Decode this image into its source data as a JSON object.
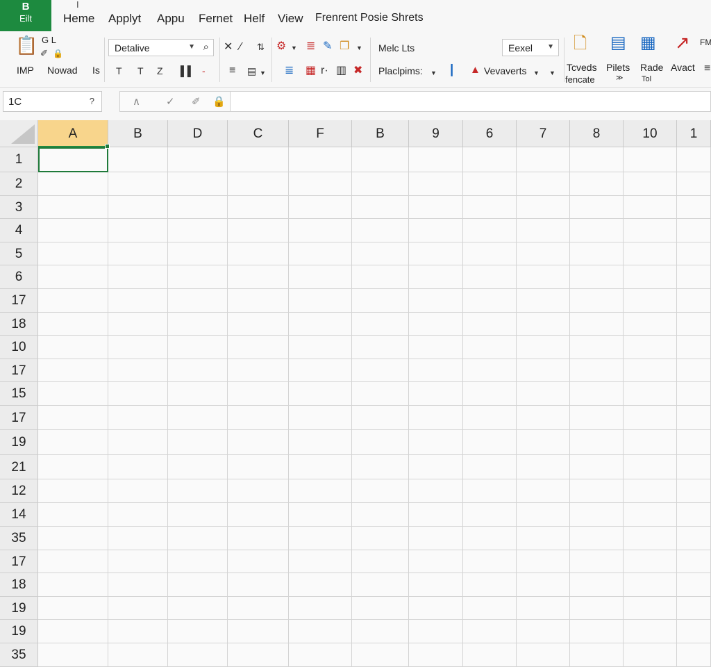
{
  "app": {
    "file_tab_line1": "B",
    "file_tab_line2": "Eilt",
    "accent_color": "#1d8a3f",
    "cursor_glyph": "I"
  },
  "menu": [
    {
      "label": "Heme"
    },
    {
      "label": "Applyt"
    },
    {
      "label": "Appu"
    },
    {
      "label": "Fernet"
    },
    {
      "label": "Helf"
    },
    {
      "label": "View"
    },
    {
      "label": "Frenrent Posie Shrets"
    }
  ],
  "ribbon": {
    "paste_label": "IMP",
    "nowad_label": "Nowad",
    "is_label": "Is",
    "gl_label": "G L",
    "font_box": "Detalive",
    "melk_label": "Melc Lts",
    "plac_label": "Placlpims:",
    "vevaverts_label": "Vevaverts",
    "format_box": "Eexel",
    "tcveds_label": "Tcveds",
    "fencate_label": "fencate",
    "pilets_label": "Pilets",
    "pilets_sub": "≫",
    "rade_label": "Rade",
    "rade_sub": "Tol",
    "avact_label": "Avact",
    "fm_label": "FM"
  },
  "icons": {
    "paste": "clipboard-icon",
    "search": "search-icon",
    "cut": "close-icon",
    "edit": "pencil-icon",
    "sort": "sort-icon"
  },
  "formula_bar": {
    "name_box": "1C",
    "name_caret": "?",
    "value": ""
  },
  "grid": {
    "columns": [
      "A",
      "B",
      "D",
      "C",
      "F",
      "B",
      "9",
      "6",
      "7",
      "8",
      "10",
      "1"
    ],
    "rows": [
      "1",
      "2",
      "3",
      "4",
      "5",
      "6",
      "17",
      "18",
      "10",
      "17",
      "15",
      "17",
      "19",
      "21",
      "12",
      "14",
      "35",
      "17",
      "18",
      "19",
      "19",
      "35"
    ],
    "selected_cell": "A1"
  }
}
